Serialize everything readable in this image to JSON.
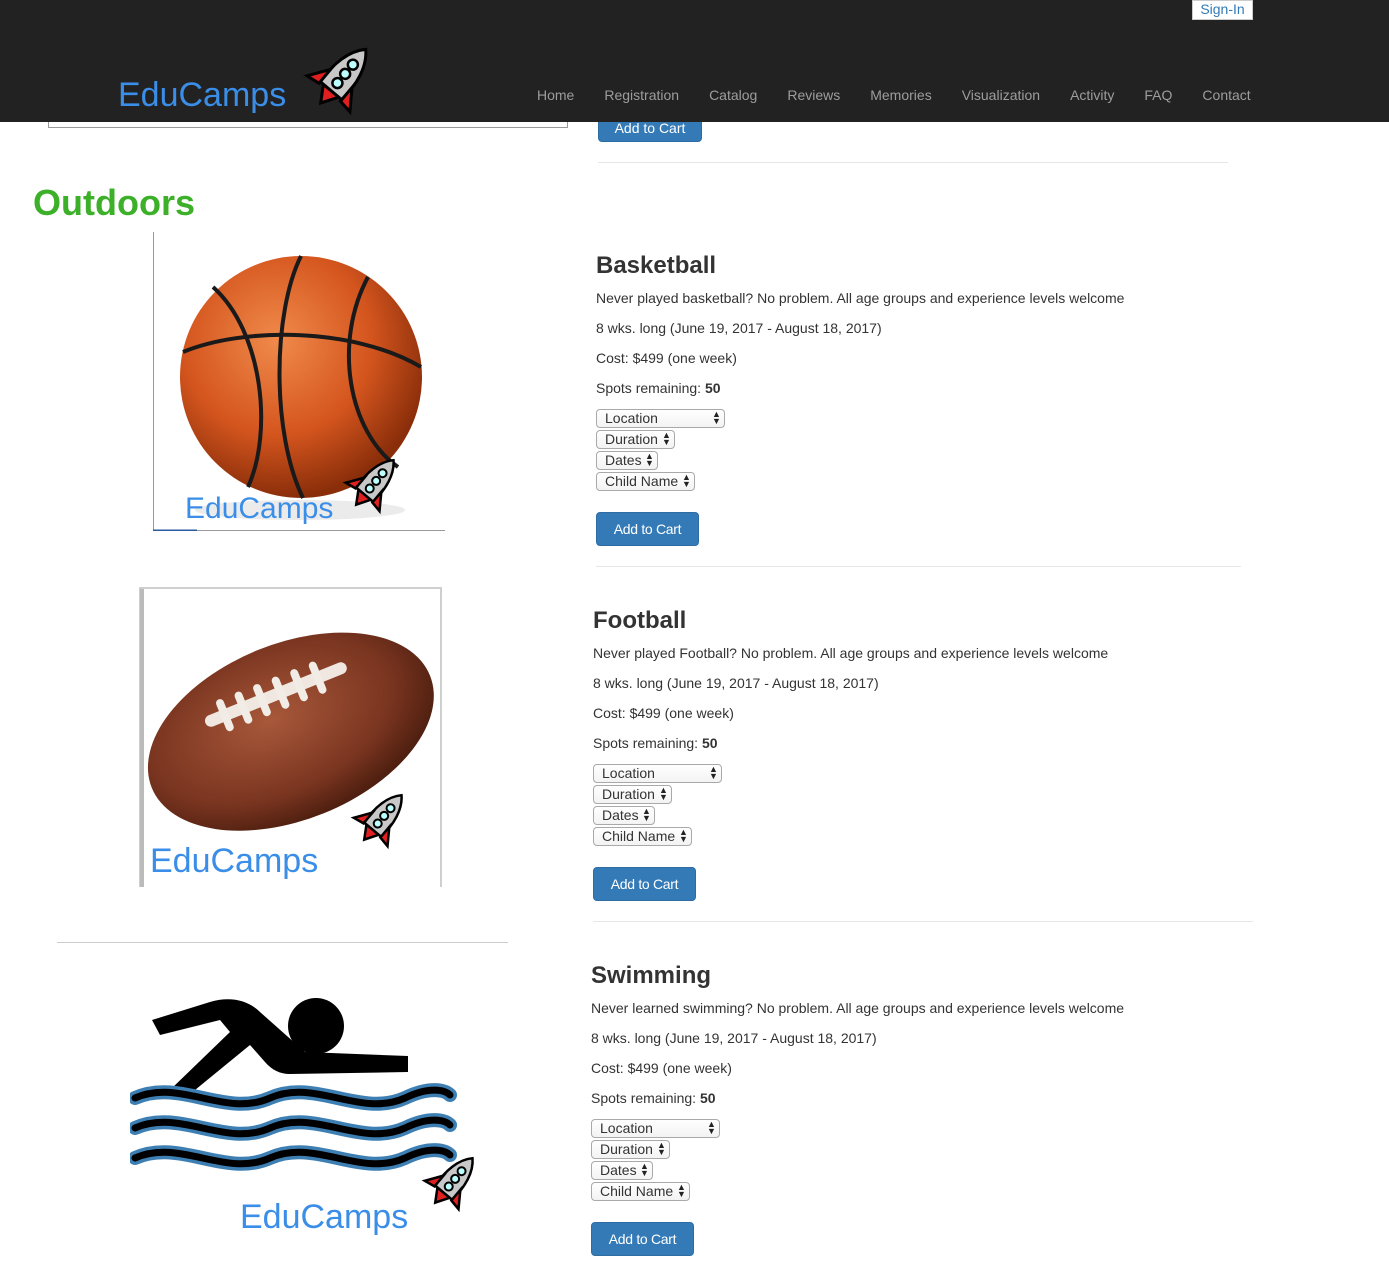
{
  "header": {
    "brand": "EduCamps",
    "signin_label": "Sign-In",
    "nav": [
      "Home",
      "Registration",
      "Catalog",
      "Reviews",
      "Memories",
      "Visualization",
      "Activity",
      "FAQ",
      "Contact"
    ]
  },
  "top": {
    "cart_label": "Add to Cart"
  },
  "section": {
    "title": "Outdoors"
  },
  "camps": [
    {
      "title": "Basketball",
      "description": "Never played basketball? No problem. All age groups and experience levels welcome",
      "duration": "8 wks. long (June 19, 2017 - August 18, 2017)",
      "cost": "Cost: $499 (one week)",
      "spots_label": "Spots remaining: ",
      "spots_value": "50",
      "selects": [
        "Location",
        "Duration",
        "Dates",
        "Child Name"
      ],
      "cart_label": "Add to Cart",
      "image_logo": "EduCamps"
    },
    {
      "title": "Football",
      "description": "Never played Football? No problem. All age groups and experience levels welcome",
      "duration": "8 wks. long (June 19, 2017 - August 18, 2017)",
      "cost": "Cost: $499 (one week)",
      "spots_label": "Spots remaining: ",
      "spots_value": "50",
      "selects": [
        "Location",
        "Duration",
        "Dates",
        "Child Name"
      ],
      "cart_label": "Add to Cart",
      "image_logo": "EduCamps"
    },
    {
      "title": "Swimming",
      "description": "Never learned swimming? No problem. All age groups and experience levels welcome",
      "duration": "8 wks. long (June 19, 2017 - August 18, 2017)",
      "cost": "Cost: $499 (one week)",
      "spots_label": "Spots remaining: ",
      "spots_value": "50",
      "selects": [
        "Location",
        "Duration",
        "Dates",
        "Child Name"
      ],
      "cart_label": "Add to Cart",
      "image_logo": "EduCamps"
    }
  ],
  "colors": {
    "navbar": "#222222",
    "accent": "#337ab7",
    "section_title": "#3cb029",
    "brand": "#3b8ee8"
  },
  "icons": [
    "rocket-icon",
    "basketball-image",
    "football-image",
    "swimmer-image"
  ]
}
